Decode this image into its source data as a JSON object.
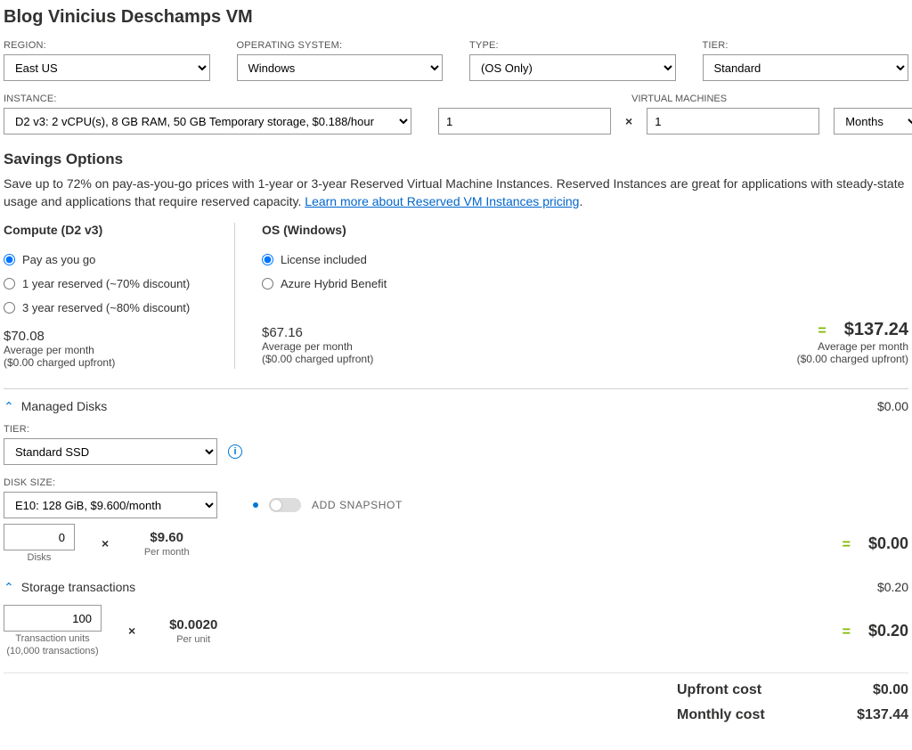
{
  "title": "Blog Vinicius Deschamps VM",
  "filters": {
    "region": {
      "label": "REGION:",
      "value": "East US"
    },
    "os": {
      "label": "OPERATING SYSTEM:",
      "value": "Windows"
    },
    "type": {
      "label": "TYPE:",
      "value": "(OS Only)"
    },
    "tier": {
      "label": "TIER:",
      "value": "Standard"
    }
  },
  "instance": {
    "label": "INSTANCE:",
    "value": "D2 v3: 2 vCPU(s), 8 GB RAM, 50 GB Temporary storage, $0.188/hour"
  },
  "vm": {
    "label": "VIRTUAL MACHINES",
    "count": "1",
    "mult": "×",
    "duration": "1",
    "unit": "Months"
  },
  "savings": {
    "heading": "Savings Options",
    "desc_pre": "Save up to 72% on pay-as-you-go prices with 1-year or 3-year Reserved Virtual Machine Instances. Reserved Instances are great for applications with steady-state usage and applications that require reserved capacity. ",
    "link_text": "Learn more about Reserved VM Instances pricing",
    "desc_post": "."
  },
  "compute": {
    "title": "Compute (D2 v3)",
    "opts": [
      "Pay as you go",
      "1 year reserved (~70% discount)",
      "3 year reserved (~80% discount)"
    ],
    "price": "$70.08",
    "sub1": "Average per month",
    "sub2": "($0.00 charged upfront)"
  },
  "os_col": {
    "title": "OS (Windows)",
    "opts": [
      "License included",
      "Azure Hybrid Benefit"
    ],
    "price": "$67.16",
    "sub1": "Average per month",
    "sub2": "($0.00 charged upfront)"
  },
  "compute_total": {
    "eq": "=",
    "amount": "$137.24",
    "sub1": "Average per month",
    "sub2": "($0.00 charged upfront)"
  },
  "managed_disks": {
    "heading": "Managed Disks",
    "line_total": "$0.00",
    "tier_label": "TIER:",
    "tier_value": "Standard SSD",
    "size_label": "DISK SIZE:",
    "size_value": "E10: 128 GiB, $9.600/month",
    "snapshot_label": "ADD SNAPSHOT",
    "qty": "0",
    "qty_label": "Disks",
    "mult": "×",
    "unit_price": "$9.60",
    "unit_label": "Per month",
    "eq": "=",
    "subtotal": "$0.00"
  },
  "storage_tx": {
    "heading": "Storage transactions",
    "line_total": "$0.20",
    "qty": "100",
    "qty_label": "Transaction units",
    "qty_label2": "(10,000 transactions)",
    "mult": "×",
    "unit_price": "$0.0020",
    "unit_label": "Per unit",
    "eq": "=",
    "subtotal": "$0.20"
  },
  "totals": {
    "upfront_label": "Upfront cost",
    "upfront_value": "$0.00",
    "monthly_label": "Monthly cost",
    "monthly_value": "$137.44"
  }
}
